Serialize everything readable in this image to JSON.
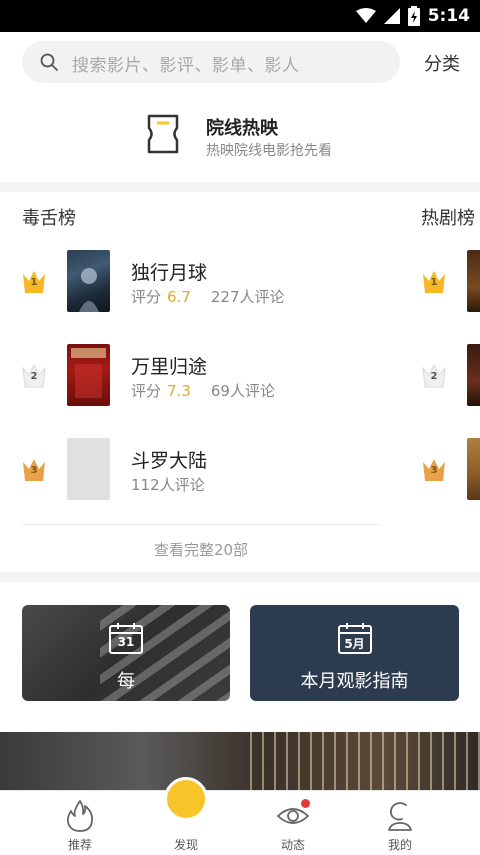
{
  "status_bar": {
    "time": "5:14"
  },
  "search": {
    "placeholder": "搜索影片、影评、影单、影人",
    "category_label": "分类"
  },
  "cinema": {
    "title": "院线热映",
    "subtitle": "热映院线电影抢先看"
  },
  "rank_lists": [
    {
      "title": "毒舌榜",
      "items": [
        {
          "rank": "1",
          "name": "独行月球",
          "score_label": "评分",
          "score": "6.7",
          "reviews": "227人评论"
        },
        {
          "rank": "2",
          "name": "万里归途",
          "score_label": "评分",
          "score": "7.3",
          "reviews": "69人评论"
        },
        {
          "rank": "3",
          "name": "斗罗大陆",
          "score_label": "",
          "score": "",
          "reviews": "112人评论"
        }
      ],
      "view_all": "查看完整20部"
    },
    {
      "title": "热剧榜",
      "items": [
        {
          "rank": "1"
        },
        {
          "rank": "2"
        },
        {
          "rank": "3"
        }
      ]
    }
  ],
  "cards": [
    {
      "label": "每",
      "calendar_number": "31"
    },
    {
      "label": "本月观影指南",
      "calendar_number": "5月"
    }
  ],
  "tabs": [
    {
      "label": "推荐",
      "icon": "flame-icon"
    },
    {
      "label": "发现",
      "icon": "discover-icon",
      "active": true
    },
    {
      "label": "动态",
      "icon": "eye-icon",
      "badge": true
    },
    {
      "label": "我的",
      "icon": "profile-icon"
    }
  ],
  "colors": {
    "accent": "#f7c52a",
    "score": "#e0a92a",
    "badge": "#e53935"
  }
}
